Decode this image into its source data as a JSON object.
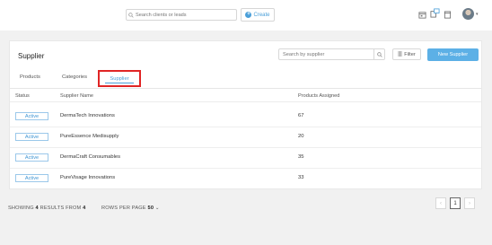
{
  "header": {
    "search_placeholder": "Search clients or leads",
    "create_label": "Create",
    "icons": [
      "calendar-icon",
      "switch-icon",
      "notes-icon",
      "avatar"
    ]
  },
  "card": {
    "title": "Supplier",
    "search_placeholder": "Search by supplier",
    "filter_label": "Filter",
    "new_button_label": "New Supplier"
  },
  "tabs": [
    {
      "label": "Products",
      "active": false
    },
    {
      "label": "Categories",
      "active": false
    },
    {
      "label": "Supplier",
      "active": true
    }
  ],
  "table": {
    "columns": [
      "Status",
      "Supplier Name",
      "Products Assigned"
    ],
    "rows": [
      {
        "status": "Active",
        "name": "DermaTech Innovations",
        "products": "67"
      },
      {
        "status": "Active",
        "name": "PureEssence Medisupply",
        "products": "20"
      },
      {
        "status": "Active",
        "name": "DermaCraft Consumables",
        "products": "35"
      },
      {
        "status": "Active",
        "name": "PureVisage Innovations",
        "products": "33"
      }
    ]
  },
  "footer": {
    "showing_prefix": "SHOWING",
    "showing_count": "4",
    "results_from": "RESULTS FROM",
    "total": "4",
    "rows_per_page_label": "ROWS PER PAGE",
    "rows_per_page_value": "50",
    "current_page": "1",
    "prev": "‹",
    "next": "›"
  },
  "colors": {
    "accent": "#4a9fd9",
    "primary_button": "#5cb0e6",
    "highlight_box": "#e02525",
    "background": "#f1f1f1"
  }
}
